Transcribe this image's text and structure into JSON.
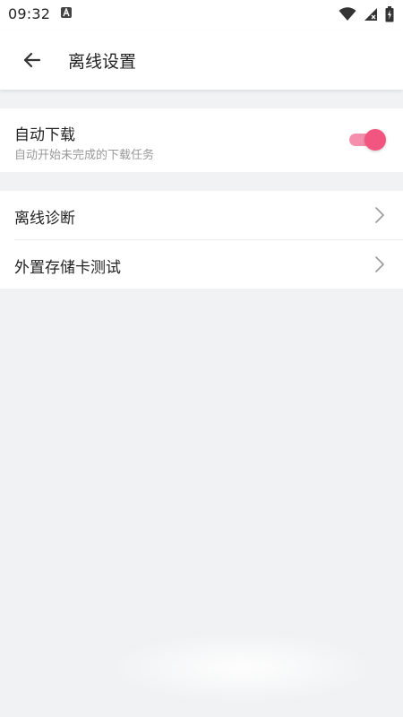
{
  "status_bar": {
    "time": "09:32",
    "icons": [
      "notification-a-icon",
      "wifi-icon",
      "signal-icon",
      "battery-icon"
    ]
  },
  "app_bar": {
    "back_icon": "back-arrow-icon",
    "title": "离线设置"
  },
  "auto_download": {
    "title": "自动下载",
    "subtitle": "自动开始未完成的下载任务",
    "enabled": true,
    "accent_color": "#f2557f"
  },
  "list": {
    "items": [
      {
        "label": "离线诊断",
        "icon": "chevron-right-icon"
      },
      {
        "label": "外置存储卡测试",
        "icon": "chevron-right-icon"
      }
    ]
  },
  "colors": {
    "background": "#f1f2f4",
    "card": "#ffffff",
    "accent": "#f2557f"
  }
}
